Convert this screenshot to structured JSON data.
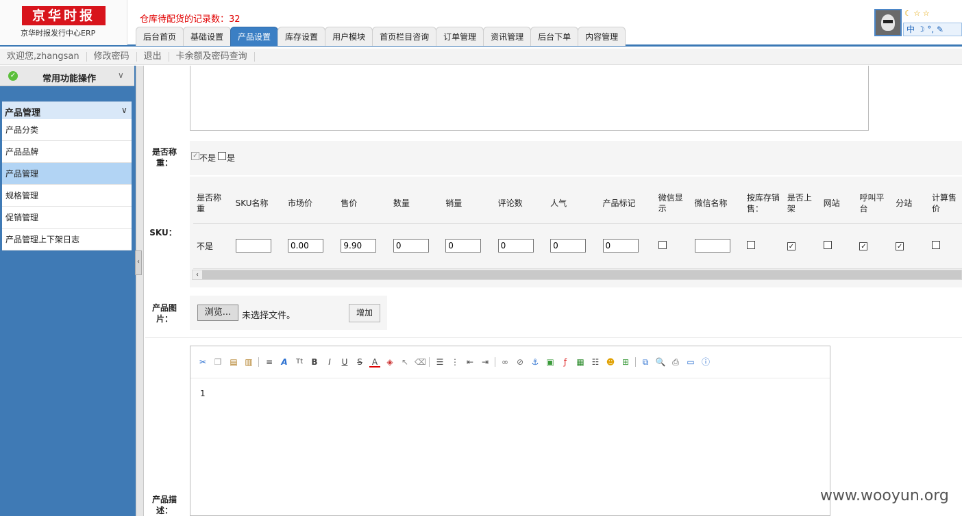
{
  "header": {
    "logo_text": "京华时报",
    "logo_subtitle": "京华时报发行中心ERP",
    "alert_text": "仓库待配货的记录数：32",
    "tabs": [
      {
        "label": "后台首页",
        "active": false
      },
      {
        "label": "基础设置",
        "active": false
      },
      {
        "label": "产品设置",
        "active": true
      },
      {
        "label": "库存设置",
        "active": false
      },
      {
        "label": "用户模块",
        "active": false
      },
      {
        "label": "首页栏目咨询",
        "active": false
      },
      {
        "label": "订单管理",
        "active": false
      },
      {
        "label": "资讯管理",
        "active": false
      },
      {
        "label": "后台下单",
        "active": false
      },
      {
        "label": "内容管理",
        "active": false
      }
    ],
    "tools_top": "☾ ☆ ☆",
    "tools_bottom": "中 ☽ °, ✎"
  },
  "subbar": {
    "welcome": "欢迎您,zhangsan",
    "change_password": "修改密码",
    "logout": "退出",
    "card_query": "卡余额及密码查询"
  },
  "sidebar": {
    "quick_title": "常用功能操作",
    "section_title": "产品管理",
    "items": [
      {
        "label": "产品分类",
        "selected": false
      },
      {
        "label": "产品品牌",
        "selected": false
      },
      {
        "label": "产品管理",
        "selected": true
      },
      {
        "label": "规格管理",
        "selected": false
      },
      {
        "label": "促销管理",
        "selected": false
      },
      {
        "label": "产品管理上下架日志",
        "selected": false
      }
    ]
  },
  "form": {
    "weigh_label": "是否称重：",
    "weigh_no": "不是",
    "weigh_yes": "是",
    "sku_label": "SKU：",
    "image_label": "产品图片：",
    "browse_button": "浏览...",
    "file_status": "未选择文件。",
    "add_button": "增加",
    "desc_label": "产品描述："
  },
  "sku": {
    "headers": [
      "是否称重",
      "SKU名称",
      "市场价",
      "售价",
      "数量",
      "销量",
      "评论数",
      "人气",
      "产品标记",
      "微信显示",
      "微信名称",
      "按库存销售：",
      "是否上架",
      "网站",
      "呼叫平台",
      "分站",
      "计算售价"
    ],
    "row": {
      "weigh": "不是",
      "sku_name": "",
      "market_price": "0.00",
      "price": "9.90",
      "quantity": "0",
      "sales": "0",
      "comments": "0",
      "popularity": "0",
      "product_mark": "0",
      "wechat_display": false,
      "wechat_name": "",
      "stock_sale": false,
      "on_shelf": true,
      "website": false,
      "call_platform": true,
      "substation": true,
      "calc_price": false
    }
  },
  "editor": {
    "content": "1"
  },
  "watermark": "www.wooyun.org",
  "colors": {
    "accent": "#3b7fc4",
    "sidebar_bg": "#3f7ab5",
    "alert": "#e10000",
    "logo_red": "#d8141c"
  }
}
